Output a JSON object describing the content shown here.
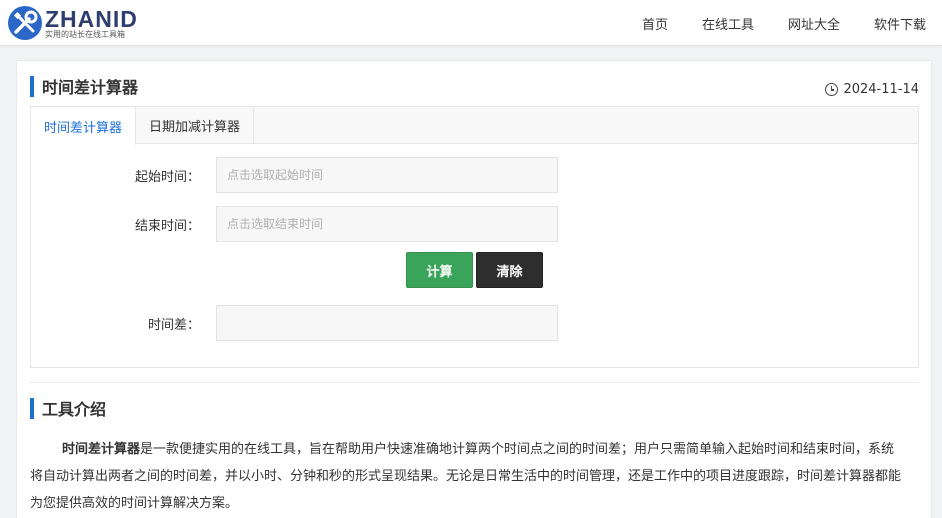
{
  "header": {
    "logo_name": "ZHANID",
    "logo_sub": "实用的站长在线工具箱",
    "nav": [
      "首页",
      "在线工具",
      "网址大全",
      "软件下载"
    ]
  },
  "page": {
    "title": "时间差计算器",
    "date": "2024-11-14"
  },
  "tabs": [
    {
      "label": "时间差计算器",
      "active": true
    },
    {
      "label": "日期加减计算器",
      "active": false
    }
  ],
  "form": {
    "start_label": "起始时间：",
    "start_placeholder": "点击选取起始时间",
    "end_label": "结束时间：",
    "end_placeholder": "点击选取结束时间",
    "calc_button": "计算",
    "clear_button": "清除",
    "result_label": "时间差：",
    "result_value": ""
  },
  "intro": {
    "title": "工具介绍",
    "bold": "时间差计算器",
    "text": "是一款便捷实用的在线工具，旨在帮助用户快速准确地计算两个时间点之间的时间差；用户只需简单输入起始时间和结束时间，系统将自动计算出两者之间的时间差，并以小时、分钟和秒的形式呈现结果。无论是日常生活中的时间管理，还是工作中的项目进度跟踪，时间差计算器都能为您提供高效的时间计算解决方案。"
  },
  "colors": {
    "accent": "#1e6fd9",
    "calc_button": "#3aa55a",
    "clear_button": "#2e2e2e"
  }
}
